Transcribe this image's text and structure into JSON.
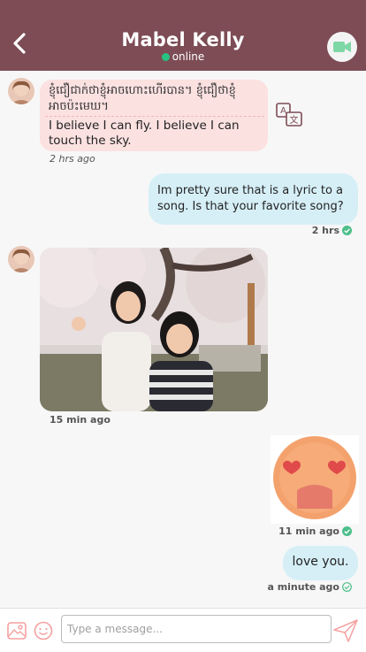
{
  "header": {
    "name": "Mabel Kelly",
    "status": "online",
    "status_color": "#26c281",
    "bg_color": "#7d4c55"
  },
  "messages": [
    {
      "direction": "in",
      "khmer_text": "ខ្ញុំជឿជាក់ថាខ្ញុំអាចហោះហើរបាន។ ខ្ញុំជឿថាខ្ញុំអាចប៉ះមេឃ។",
      "text": "I believe I can fly. I believe I can touch the sky.",
      "time": "2 hrs ago"
    },
    {
      "direction": "out",
      "text": "Im pretty sure that is a lyric to a song. Is that your favorite song?",
      "time": "2 hrs"
    },
    {
      "direction": "in",
      "type": "photo",
      "time": "15 min ago"
    },
    {
      "direction": "out",
      "type": "emoji",
      "emoji": "heart-eyes-face",
      "time": "11 min ago"
    },
    {
      "direction": "out",
      "text": "love you.",
      "time": "a minute ago"
    }
  ],
  "composer": {
    "placeholder": "Type a message..."
  },
  "colors": {
    "incoming_bubble": "#fce1e1",
    "outgoing_bubble": "#d6eff7",
    "read_check": "#4cbf8a"
  },
  "icons": [
    "back-arrow-icon",
    "video-camera-icon",
    "translate-icon",
    "read-check-icon",
    "image-icon",
    "emoji-icon",
    "send-icon"
  ]
}
